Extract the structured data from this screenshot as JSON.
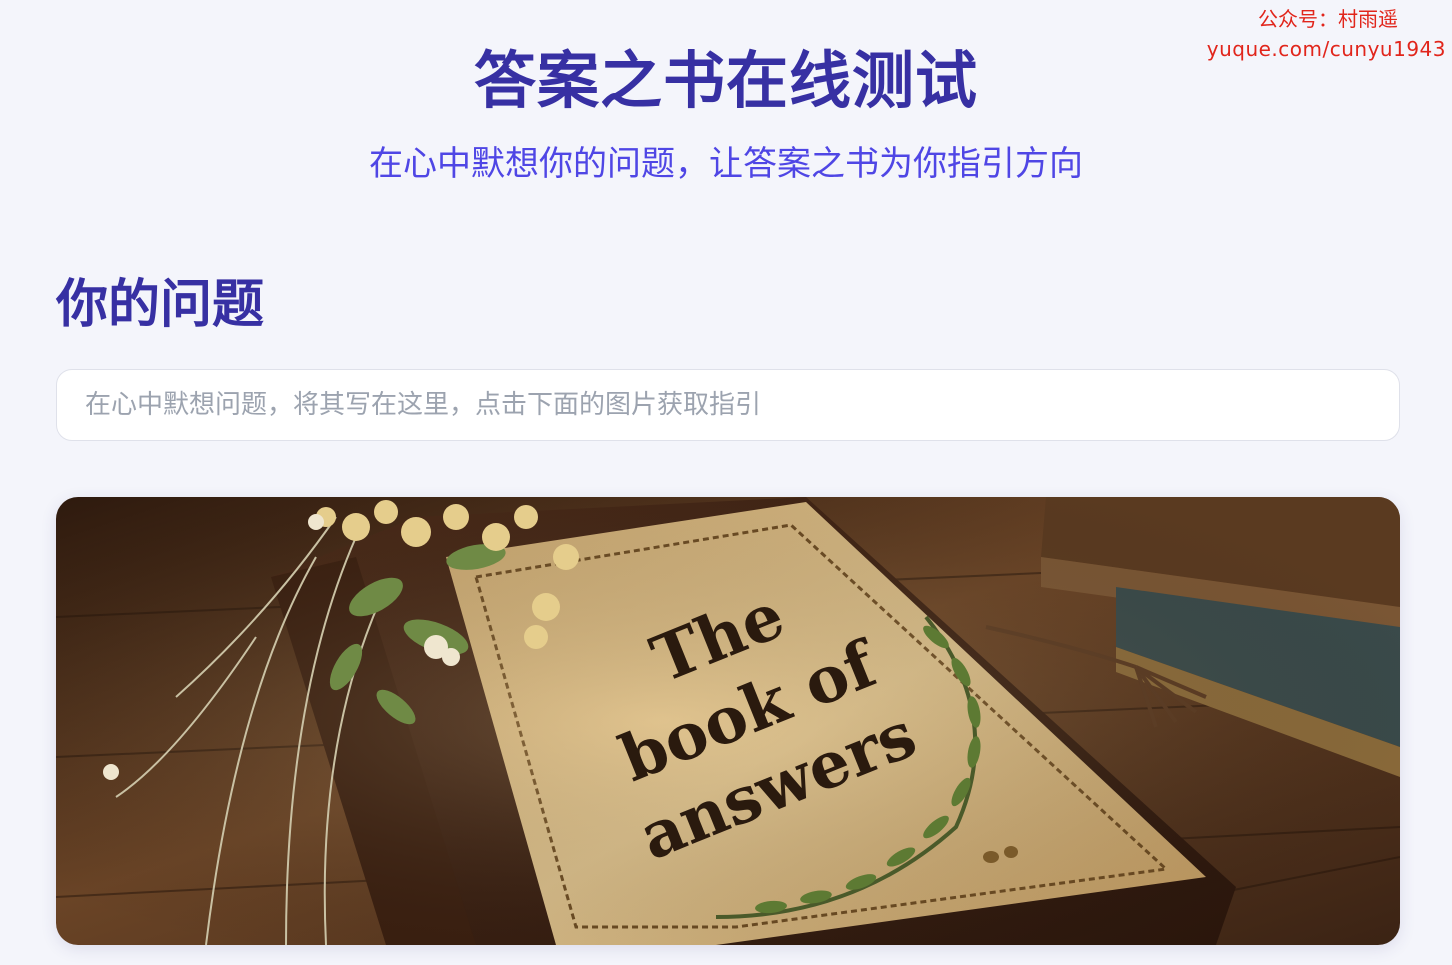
{
  "watermark": {
    "line1": "公众号：村雨遥",
    "line2": "yuque.com/cunyu1943"
  },
  "header": {
    "title": "答案之书在线测试",
    "subtitle": "在心中默想你的问题，让答案之书为你指引方向"
  },
  "question": {
    "heading": "你的问题",
    "placeholder": "在心中默想问题，将其写在这里，点击下面的图片获取指引",
    "value": ""
  },
  "book_image": {
    "cover_text": [
      "The",
      "book of",
      "answers"
    ]
  },
  "colors": {
    "background": "#f4f5fb",
    "title": "#3730a3",
    "subtitle": "#4f46e5",
    "watermark": "#e1251b"
  }
}
